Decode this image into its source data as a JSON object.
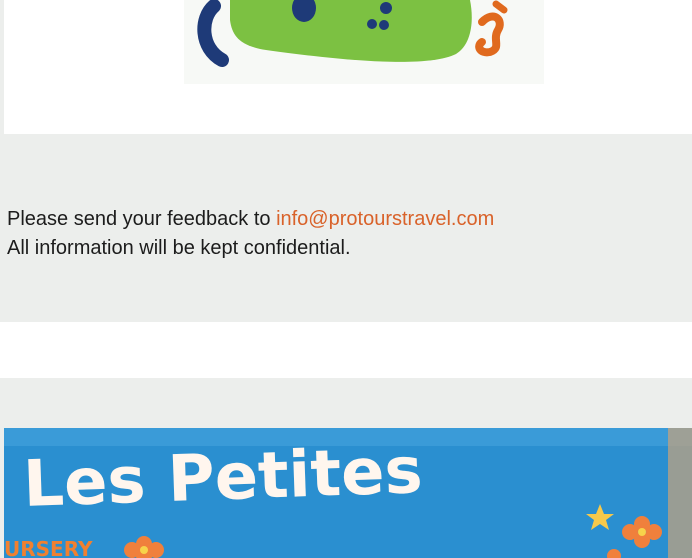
{
  "feedback": {
    "line1_prefix": "Please send your feedback to ",
    "email": "info@protourstravel.com",
    "line2": "All information will be kept confidential."
  },
  "bottom_image": {
    "sign_text": "Les Petites",
    "sub_text": "URSERY"
  },
  "colors": {
    "link": "#d9622a",
    "panel_gray": "#eceeec",
    "logo_green": "#7cc142",
    "logo_navy": "#1e3a78",
    "logo_orange": "#e06a1e",
    "sign_blue": "#2a8fd0"
  }
}
